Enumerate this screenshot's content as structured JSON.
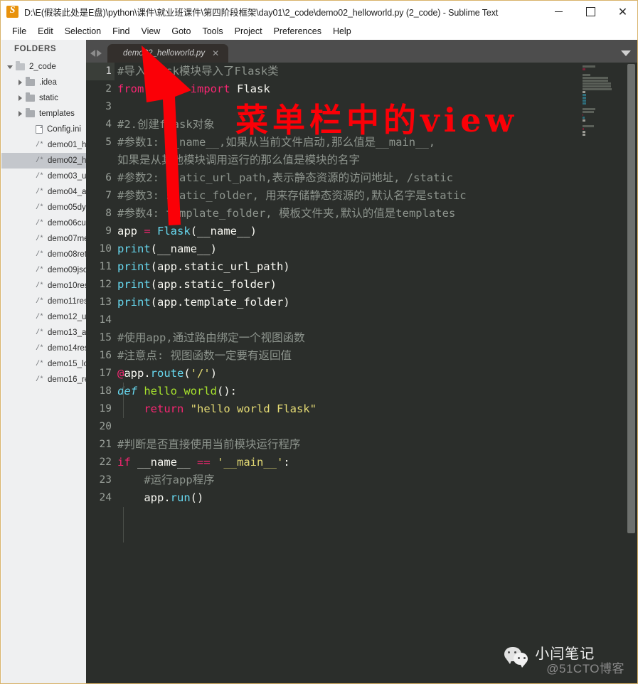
{
  "window": {
    "title": "D:\\E(假装此处是E盘)\\python\\课件\\就业班课件\\第四阶段框架\\day01\\2_code\\demo02_helloworld.py (2_code) - Sublime Text",
    "app_icon": "sublime-text-logo",
    "minimize_label": "",
    "maximize_label": "",
    "close_label": "✕"
  },
  "menu": {
    "items": [
      {
        "label": "File"
      },
      {
        "label": "Edit"
      },
      {
        "label": "Selection"
      },
      {
        "label": "Find"
      },
      {
        "label": "View"
      },
      {
        "label": "Goto"
      },
      {
        "label": "Tools"
      },
      {
        "label": "Project"
      },
      {
        "label": "Preferences"
      },
      {
        "label": "Help"
      }
    ]
  },
  "sidebar": {
    "header": "FOLDERS",
    "items": [
      {
        "label": "2_code",
        "type": "folder-open",
        "depth": 0,
        "expanded": true,
        "selected": false
      },
      {
        "label": ".idea",
        "type": "folder",
        "depth": 1,
        "expanded": false,
        "selected": false
      },
      {
        "label": "static",
        "type": "folder",
        "depth": 1,
        "expanded": false,
        "selected": false
      },
      {
        "label": "templates",
        "type": "folder",
        "depth": 1,
        "expanded": false,
        "selected": false
      },
      {
        "label": "Config.ini",
        "type": "file",
        "depth": 2,
        "expanded": null,
        "selected": false
      },
      {
        "label": "demo01_h",
        "type": "python",
        "depth": 2,
        "expanded": null,
        "selected": false
      },
      {
        "label": "demo02_h",
        "type": "python",
        "depth": 2,
        "expanded": null,
        "selected": true
      },
      {
        "label": "demo03_u",
        "type": "python",
        "depth": 2,
        "expanded": null,
        "selected": false
      },
      {
        "label": "demo04_a",
        "type": "python",
        "depth": 2,
        "expanded": null,
        "selected": false
      },
      {
        "label": "demo05dy",
        "type": "python",
        "depth": 2,
        "expanded": null,
        "selected": false
      },
      {
        "label": "demo06cu",
        "type": "python",
        "depth": 2,
        "expanded": null,
        "selected": false
      },
      {
        "label": "demo07me",
        "type": "python",
        "depth": 2,
        "expanded": null,
        "selected": false
      },
      {
        "label": "demo08ret",
        "type": "python",
        "depth": 2,
        "expanded": null,
        "selected": false
      },
      {
        "label": "demo09jso",
        "type": "python",
        "depth": 2,
        "expanded": null,
        "selected": false
      },
      {
        "label": "demo10res",
        "type": "python",
        "depth": 2,
        "expanded": null,
        "selected": false
      },
      {
        "label": "demo11res",
        "type": "python",
        "depth": 2,
        "expanded": null,
        "selected": false
      },
      {
        "label": "demo12_u",
        "type": "python",
        "depth": 2,
        "expanded": null,
        "selected": false
      },
      {
        "label": "demo13_a",
        "type": "python",
        "depth": 2,
        "expanded": null,
        "selected": false
      },
      {
        "label": "demo14res",
        "type": "python",
        "depth": 2,
        "expanded": null,
        "selected": false
      },
      {
        "label": "demo15_lo",
        "type": "python",
        "depth": 2,
        "expanded": null,
        "selected": false
      },
      {
        "label": "demo16_re",
        "type": "python",
        "depth": 2,
        "expanded": null,
        "selected": false
      }
    ]
  },
  "tabs": {
    "nav_prev": "◀",
    "nav_next": "▶",
    "open": [
      {
        "label": "demo02_helloworld.py",
        "close": "✕",
        "active": true
      }
    ],
    "overflow_caret": "▼"
  },
  "editor": {
    "active_line": 1,
    "lines": [
      {
        "n": "1",
        "tokens": [
          {
            "t": "#导入flask模块导入了Flask类",
            "c": "c-comment"
          }
        ]
      },
      {
        "n": "2",
        "tokens": [
          {
            "t": "from",
            "c": "c-kw"
          },
          {
            "t": " flask ",
            "c": "c-white"
          },
          {
            "t": "import",
            "c": "c-kw"
          },
          {
            "t": " Flask",
            "c": "c-white"
          }
        ]
      },
      {
        "n": "3",
        "tokens": [
          {
            "t": "",
            "c": "c-plain"
          }
        ]
      },
      {
        "n": "4",
        "tokens": [
          {
            "t": "#2.创建flask对象",
            "c": "c-comment"
          }
        ]
      },
      {
        "n": "5",
        "tokens": [
          {
            "t": "#参数1: __name__,如果从当前文件启动,那么值是__main__,",
            "c": "c-comment"
          },
          {
            "t": "\n如果是从其他模块调用运行的那么值是模块的名字",
            "c": "c-comment"
          }
        ],
        "wrapped": true
      },
      {
        "n": "6",
        "tokens": [
          {
            "t": "#参数2: static_url_path,表示静态资源的访问地址, /static",
            "c": "c-comment"
          }
        ]
      },
      {
        "n": "7",
        "tokens": [
          {
            "t": "#参数3: static_folder, 用来存储静态资源的,默认名字是static",
            "c": "c-comment"
          }
        ]
      },
      {
        "n": "8",
        "tokens": [
          {
            "t": "#参数4: template_folder, 模板文件夹,默认的值是templates",
            "c": "c-comment"
          }
        ]
      },
      {
        "n": "9",
        "tokens": [
          {
            "t": "app ",
            "c": "c-white"
          },
          {
            "t": "=",
            "c": "c-kw"
          },
          {
            "t": " ",
            "c": "c-white"
          },
          {
            "t": "Flask",
            "c": "c-fn"
          },
          {
            "t": "(__name__)",
            "c": "c-white"
          }
        ]
      },
      {
        "n": "10",
        "tokens": [
          {
            "t": "print",
            "c": "c-fn"
          },
          {
            "t": "(__name__)",
            "c": "c-white"
          }
        ]
      },
      {
        "n": "11",
        "tokens": [
          {
            "t": "print",
            "c": "c-fn"
          },
          {
            "t": "(app.static_url_path)",
            "c": "c-white"
          }
        ]
      },
      {
        "n": "12",
        "tokens": [
          {
            "t": "print",
            "c": "c-fn"
          },
          {
            "t": "(app.static_folder)",
            "c": "c-white"
          }
        ]
      },
      {
        "n": "13",
        "tokens": [
          {
            "t": "print",
            "c": "c-fn"
          },
          {
            "t": "(app.template_folder)",
            "c": "c-white"
          }
        ]
      },
      {
        "n": "14",
        "tokens": [
          {
            "t": "",
            "c": "c-plain"
          }
        ]
      },
      {
        "n": "15",
        "tokens": [
          {
            "t": "#使用app,通过路由绑定一个视图函数",
            "c": "c-comment"
          }
        ]
      },
      {
        "n": "16",
        "tokens": [
          {
            "t": "#注意点: 视图函数一定要有返回值",
            "c": "c-comment"
          }
        ]
      },
      {
        "n": "17",
        "tokens": [
          {
            "t": "@",
            "c": "c-kw"
          },
          {
            "t": "app.",
            "c": "c-white"
          },
          {
            "t": "route",
            "c": "c-fn"
          },
          {
            "t": "(",
            "c": "c-white"
          },
          {
            "t": "'/'",
            "c": "c-str"
          },
          {
            "t": ")",
            "c": "c-white"
          }
        ]
      },
      {
        "n": "18",
        "tokens": [
          {
            "t": "def",
            "c": "c-def"
          },
          {
            "t": " ",
            "c": "c-white"
          },
          {
            "t": "hello_world",
            "c": "c-name"
          },
          {
            "t": "():",
            "c": "c-white"
          }
        ]
      },
      {
        "n": "19",
        "tokens": [
          {
            "t": "    ",
            "c": "c-white"
          },
          {
            "t": "return",
            "c": "c-kw"
          },
          {
            "t": " ",
            "c": "c-white"
          },
          {
            "t": "\"hello world Flask\"",
            "c": "c-str"
          }
        ]
      },
      {
        "n": "20",
        "tokens": [
          {
            "t": "",
            "c": "c-plain"
          }
        ]
      },
      {
        "n": "21",
        "tokens": [
          {
            "t": "#判断是否直接使用当前模块运行程序",
            "c": "c-comment"
          }
        ]
      },
      {
        "n": "22",
        "tokens": [
          {
            "t": "if",
            "c": "c-kw"
          },
          {
            "t": " __name__ ",
            "c": "c-white"
          },
          {
            "t": "==",
            "c": "c-kw"
          },
          {
            "t": " ",
            "c": "c-white"
          },
          {
            "t": "'__main__'",
            "c": "c-str"
          },
          {
            "t": ":",
            "c": "c-white"
          }
        ]
      },
      {
        "n": "23",
        "tokens": [
          {
            "t": "    ",
            "c": "c-white"
          },
          {
            "t": "#运行app程序",
            "c": "c-comment"
          }
        ]
      },
      {
        "n": "24",
        "tokens": [
          {
            "t": "    ",
            "c": "c-white"
          },
          {
            "t": "app.",
            "c": "c-white"
          },
          {
            "t": "run",
            "c": "c-fn"
          },
          {
            "t": "()",
            "c": "c-white"
          }
        ]
      }
    ]
  },
  "annotation": {
    "text": "菜单栏中的view",
    "color": "#fb0007",
    "arrow": "red-up-left-arrow"
  },
  "watermark": {
    "icon": "wechat-icon",
    "name": "小闫笔记",
    "subtitle": "@51CTO博客"
  },
  "colors": {
    "accent_orange": "#e8920c",
    "editor_bg": "#2b2e2b",
    "sidebar_bg": "#eff0f1",
    "tabbar_bg": "#4d4d4d",
    "annotation_red": "#fb0007"
  }
}
